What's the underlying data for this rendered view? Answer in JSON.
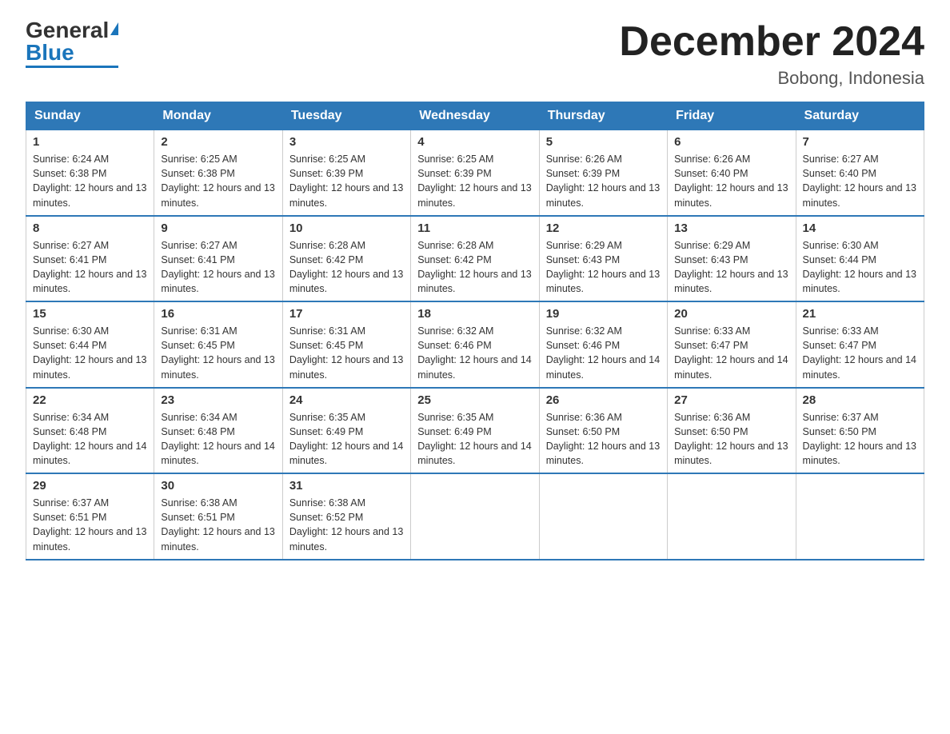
{
  "logo": {
    "general": "General",
    "blue": "Blue"
  },
  "title": "December 2024",
  "subtitle": "Bobong, Indonesia",
  "days_of_week": [
    "Sunday",
    "Monday",
    "Tuesday",
    "Wednesday",
    "Thursday",
    "Friday",
    "Saturday"
  ],
  "weeks": [
    [
      {
        "day": "1",
        "sunrise": "6:24 AM",
        "sunset": "6:38 PM",
        "daylight": "12 hours and 13 minutes."
      },
      {
        "day": "2",
        "sunrise": "6:25 AM",
        "sunset": "6:38 PM",
        "daylight": "12 hours and 13 minutes."
      },
      {
        "day": "3",
        "sunrise": "6:25 AM",
        "sunset": "6:39 PM",
        "daylight": "12 hours and 13 minutes."
      },
      {
        "day": "4",
        "sunrise": "6:25 AM",
        "sunset": "6:39 PM",
        "daylight": "12 hours and 13 minutes."
      },
      {
        "day": "5",
        "sunrise": "6:26 AM",
        "sunset": "6:39 PM",
        "daylight": "12 hours and 13 minutes."
      },
      {
        "day": "6",
        "sunrise": "6:26 AM",
        "sunset": "6:40 PM",
        "daylight": "12 hours and 13 minutes."
      },
      {
        "day": "7",
        "sunrise": "6:27 AM",
        "sunset": "6:40 PM",
        "daylight": "12 hours and 13 minutes."
      }
    ],
    [
      {
        "day": "8",
        "sunrise": "6:27 AM",
        "sunset": "6:41 PM",
        "daylight": "12 hours and 13 minutes."
      },
      {
        "day": "9",
        "sunrise": "6:27 AM",
        "sunset": "6:41 PM",
        "daylight": "12 hours and 13 minutes."
      },
      {
        "day": "10",
        "sunrise": "6:28 AM",
        "sunset": "6:42 PM",
        "daylight": "12 hours and 13 minutes."
      },
      {
        "day": "11",
        "sunrise": "6:28 AM",
        "sunset": "6:42 PM",
        "daylight": "12 hours and 13 minutes."
      },
      {
        "day": "12",
        "sunrise": "6:29 AM",
        "sunset": "6:43 PM",
        "daylight": "12 hours and 13 minutes."
      },
      {
        "day": "13",
        "sunrise": "6:29 AM",
        "sunset": "6:43 PM",
        "daylight": "12 hours and 13 minutes."
      },
      {
        "day": "14",
        "sunrise": "6:30 AM",
        "sunset": "6:44 PM",
        "daylight": "12 hours and 13 minutes."
      }
    ],
    [
      {
        "day": "15",
        "sunrise": "6:30 AM",
        "sunset": "6:44 PM",
        "daylight": "12 hours and 13 minutes."
      },
      {
        "day": "16",
        "sunrise": "6:31 AM",
        "sunset": "6:45 PM",
        "daylight": "12 hours and 13 minutes."
      },
      {
        "day": "17",
        "sunrise": "6:31 AM",
        "sunset": "6:45 PM",
        "daylight": "12 hours and 13 minutes."
      },
      {
        "day": "18",
        "sunrise": "6:32 AM",
        "sunset": "6:46 PM",
        "daylight": "12 hours and 14 minutes."
      },
      {
        "day": "19",
        "sunrise": "6:32 AM",
        "sunset": "6:46 PM",
        "daylight": "12 hours and 14 minutes."
      },
      {
        "day": "20",
        "sunrise": "6:33 AM",
        "sunset": "6:47 PM",
        "daylight": "12 hours and 14 minutes."
      },
      {
        "day": "21",
        "sunrise": "6:33 AM",
        "sunset": "6:47 PM",
        "daylight": "12 hours and 14 minutes."
      }
    ],
    [
      {
        "day": "22",
        "sunrise": "6:34 AM",
        "sunset": "6:48 PM",
        "daylight": "12 hours and 14 minutes."
      },
      {
        "day": "23",
        "sunrise": "6:34 AM",
        "sunset": "6:48 PM",
        "daylight": "12 hours and 14 minutes."
      },
      {
        "day": "24",
        "sunrise": "6:35 AM",
        "sunset": "6:49 PM",
        "daylight": "12 hours and 14 minutes."
      },
      {
        "day": "25",
        "sunrise": "6:35 AM",
        "sunset": "6:49 PM",
        "daylight": "12 hours and 14 minutes."
      },
      {
        "day": "26",
        "sunrise": "6:36 AM",
        "sunset": "6:50 PM",
        "daylight": "12 hours and 13 minutes."
      },
      {
        "day": "27",
        "sunrise": "6:36 AM",
        "sunset": "6:50 PM",
        "daylight": "12 hours and 13 minutes."
      },
      {
        "day": "28",
        "sunrise": "6:37 AM",
        "sunset": "6:50 PM",
        "daylight": "12 hours and 13 minutes."
      }
    ],
    [
      {
        "day": "29",
        "sunrise": "6:37 AM",
        "sunset": "6:51 PM",
        "daylight": "12 hours and 13 minutes."
      },
      {
        "day": "30",
        "sunrise": "6:38 AM",
        "sunset": "6:51 PM",
        "daylight": "12 hours and 13 minutes."
      },
      {
        "day": "31",
        "sunrise": "6:38 AM",
        "sunset": "6:52 PM",
        "daylight": "12 hours and 13 minutes."
      },
      null,
      null,
      null,
      null
    ]
  ]
}
